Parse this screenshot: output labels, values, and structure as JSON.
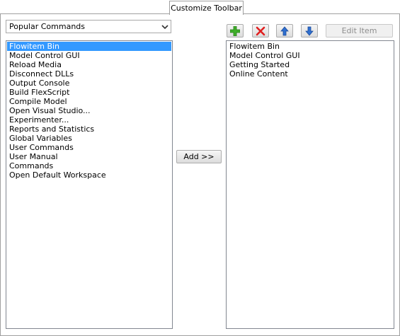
{
  "tab": {
    "label": "Customize Toolbar"
  },
  "dropdown": {
    "selected": "Popular Commands"
  },
  "left_list": {
    "items": [
      "Flowitem Bin",
      "Model Control GUI",
      "Reload Media",
      "Disconnect DLLs",
      "Output Console",
      "Build FlexScript",
      "Compile Model",
      "Open Visual Studio...",
      "Experimenter...",
      "Reports and Statistics",
      "Global Variables",
      "User Commands",
      "User Manual",
      "Commands",
      "Open Default Workspace"
    ],
    "selected_index": 0
  },
  "add_button": {
    "label": "Add >>"
  },
  "toolbar": {
    "add_icon": "plus-icon",
    "remove_icon": "x-icon",
    "up_icon": "arrow-up-icon",
    "down_icon": "arrow-down-icon",
    "edit_label": "Edit Item"
  },
  "right_list": {
    "items": [
      "Flowitem Bin",
      "Model Control GUI",
      "Getting Started",
      "Online Content"
    ]
  },
  "colors": {
    "selection": "#3399ff",
    "plus": "#3fae29",
    "remove": "#e02020",
    "arrows": "#2f6fcf"
  }
}
